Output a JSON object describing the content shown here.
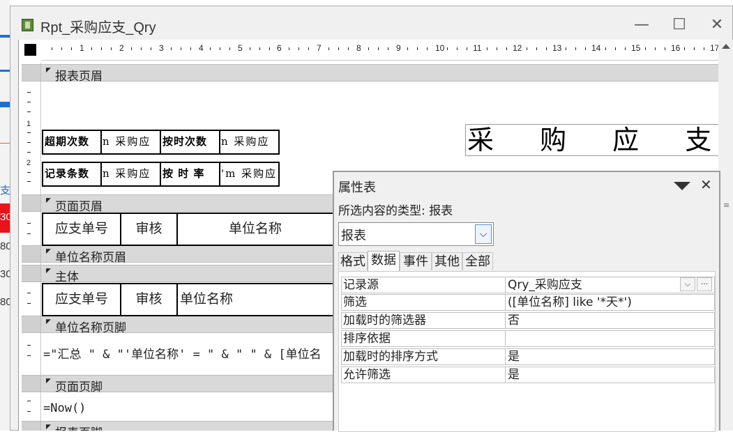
{
  "background_window": {
    "chars": [
      "支",
      "30",
      "80",
      "30",
      "80"
    ]
  },
  "window": {
    "title": "Rpt_采购应支_Qry",
    "minimize_glyph": "—",
    "maximize_glyph": "☐",
    "close_glyph": "✕"
  },
  "ruler": {
    "numbers": [
      "1",
      "2",
      "3",
      "4",
      "5",
      "6",
      "7",
      "8",
      "9",
      "10",
      "11",
      "12",
      "13",
      "14",
      "15",
      "16",
      "17"
    ],
    "vertical_numbers": [
      "1",
      "2"
    ]
  },
  "sections": {
    "report_header": "报表页眉",
    "page_header": "页面页眉",
    "group_header": "单位名称页眉",
    "detail": "主体",
    "group_footer": "单位名称页脚",
    "page_footer": "页面页脚",
    "report_footer": "报表页脚"
  },
  "report_header_controls": {
    "overdue_label": "超期次数",
    "overdue_value": "n 采购应",
    "ontime_label": "按时次数",
    "ontime_value": "n 采购应",
    "records_label": "记录条数",
    "records_value": "n 采购应",
    "ontime_rate_label": "按 时 率",
    "ontime_rate_value": "'m 采购应",
    "big_title": "采 购 应 支 报 表"
  },
  "page_header_cells": {
    "doc_no": "应支单号",
    "audit": "审核",
    "unit_name": "单位名称"
  },
  "detail_cells": {
    "doc_no": "应支单号",
    "audit": "审核",
    "unit_name": "单位名称"
  },
  "group_footer_expr": "=\"汇总 \" & \"'单位名称' = \" & \" \" & [单位名",
  "page_footer_expr": "=Now()",
  "property_sheet": {
    "title": "属性表",
    "selection_type": "所选内容的类型: 报表",
    "combo_value": "报表",
    "tabs": [
      "格式",
      "数据",
      "事件",
      "其他",
      "全部"
    ],
    "active_tab": "数据",
    "rows": [
      {
        "key": "记录源",
        "value": "Qry_采购应支"
      },
      {
        "key": "筛选",
        "value": "([单位名称] like '*天*')"
      },
      {
        "key": "加载时的筛选器",
        "value": "否"
      },
      {
        "key": "排序依据",
        "value": ""
      },
      {
        "key": "加载时的排序方式",
        "value": "是"
      },
      {
        "key": "允许筛选",
        "value": "是"
      }
    ]
  },
  "colors": {
    "band": "#d9d9d9",
    "bg_red": "#e8131b",
    "bg_blue": "#1c6fd1"
  }
}
